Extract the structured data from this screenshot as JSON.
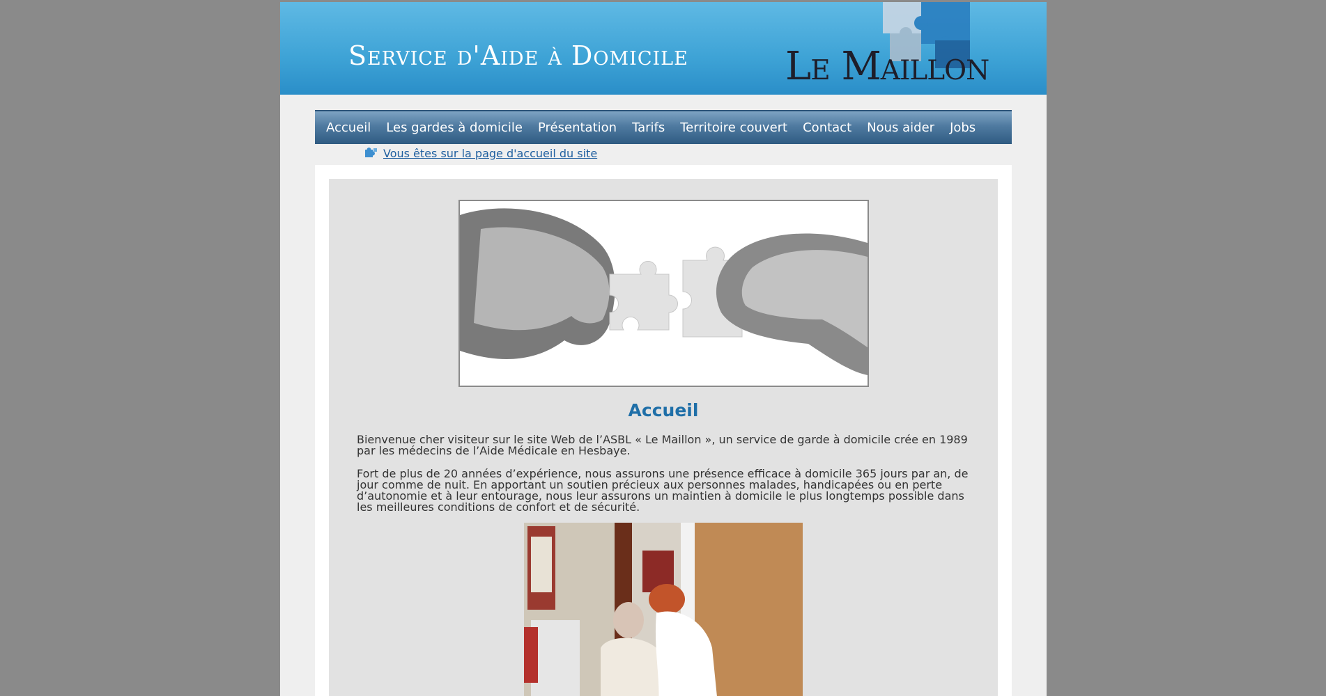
{
  "banner": {
    "title": "Service d'Aide à Domicile",
    "logo": "Le Maillon"
  },
  "nav": {
    "items": [
      "Accueil",
      "Les gardes à domicile",
      "Présentation",
      "Tarifs",
      "Territoire couvert",
      "Contact",
      "Nous aider",
      "Jobs"
    ]
  },
  "breadcrumb": {
    "icon": "puzzle-piece-icon",
    "text": "Vous êtes sur la page d'accueil du site"
  },
  "main": {
    "heading": "Accueil",
    "paragraphs": [
      "Bienvenue cher visiteur sur le site Web de l’ASBL « Le Maillon », un service de garde à domicile crée en 1989 par les médecins de l’Aide Médicale en Hesbaye.",
      "Fort de plus de 20 années d’expérience, nous assurons une présence efficace à domicile 365 jours par an, de jour comme de nuit. En apportant un soutien précieux aux personnes malades, handicapées ou en perte d’autonomie et à leur entourage, nous leur assurons un maintien à domicile le plus longtemps possible dans les meilleures conditions de confort et de sécurité."
    ]
  },
  "colors": {
    "banner": "#3ea3d6",
    "nav": "#4f7aa0",
    "heading": "#1f6fa8",
    "link": "#2060a0"
  }
}
